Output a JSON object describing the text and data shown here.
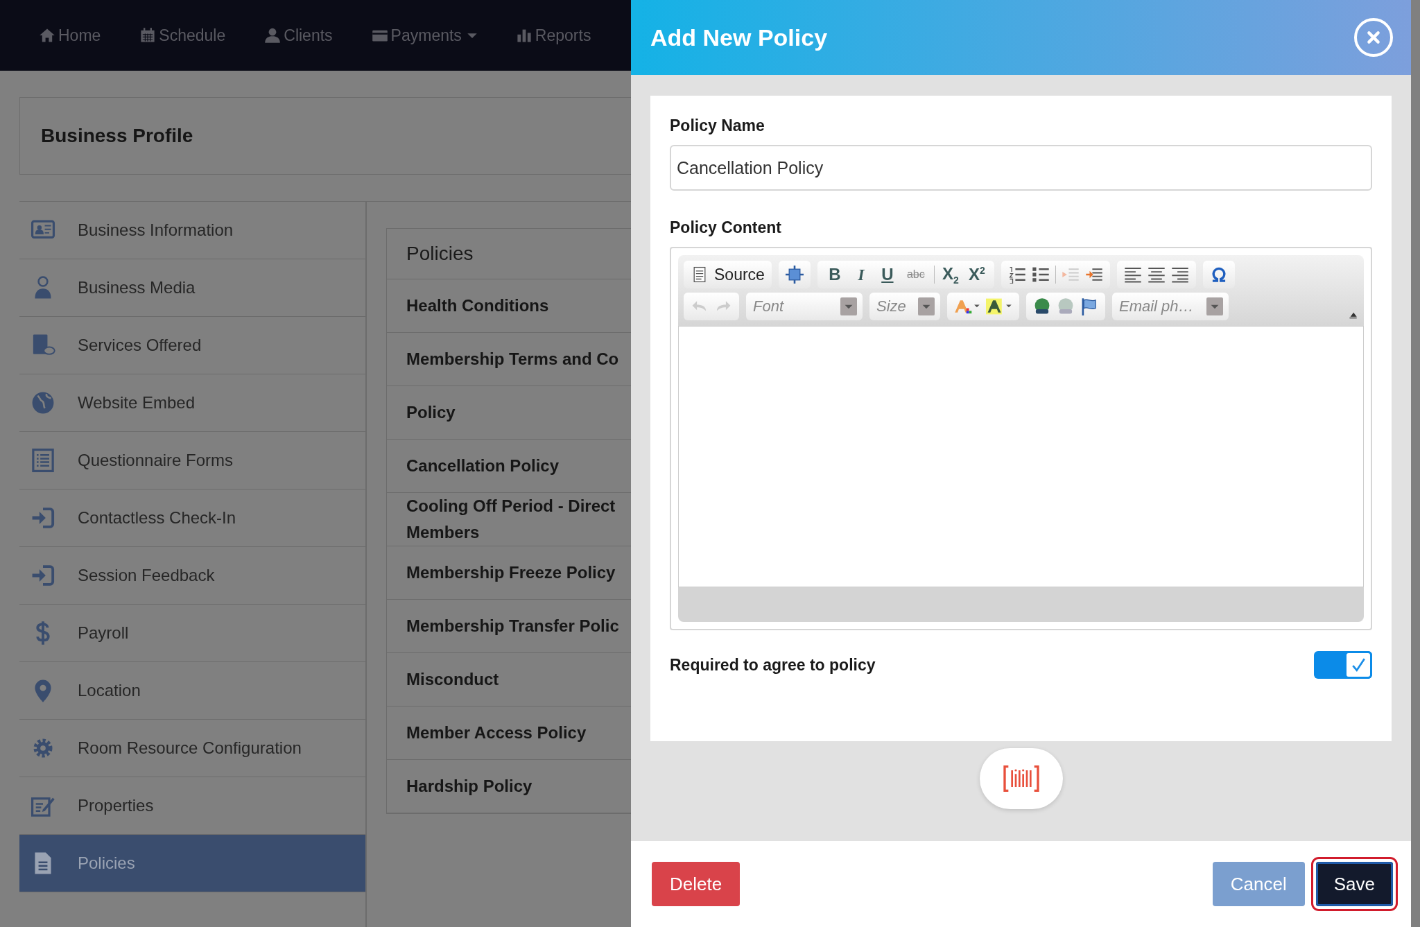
{
  "nav": {
    "items": [
      {
        "label": "Home",
        "dropdown": false
      },
      {
        "label": "Schedule",
        "dropdown": false
      },
      {
        "label": "Clients",
        "dropdown": false
      },
      {
        "label": "Payments",
        "dropdown": true
      },
      {
        "label": "Reports",
        "dropdown": false
      }
    ]
  },
  "page": {
    "title": "Business Profile"
  },
  "sidebar": {
    "items": [
      {
        "label": "Business Information",
        "selected": false
      },
      {
        "label": "Business Media",
        "selected": false
      },
      {
        "label": "Services Offered",
        "selected": false
      },
      {
        "label": "Website Embed",
        "selected": false
      },
      {
        "label": "Questionnaire Forms",
        "selected": false
      },
      {
        "label": "Contactless Check-In",
        "selected": false
      },
      {
        "label": "Session Feedback",
        "selected": false
      },
      {
        "label": "Payroll",
        "selected": false
      },
      {
        "label": "Location",
        "selected": false
      },
      {
        "label": "Room Resource Configuration",
        "selected": false
      },
      {
        "label": "Properties",
        "selected": false
      },
      {
        "label": "Policies",
        "selected": true
      }
    ]
  },
  "policies": {
    "title": "Policies",
    "items": [
      "Health Conditions",
      "Membership Terms and Co",
      "Policy",
      "Cancellation Policy",
      "Cooling Off Period - Direct Members",
      "Membership Freeze Policy",
      "Membership Transfer Polic",
      "Misconduct",
      "Member Access Policy",
      "Hardship Policy"
    ]
  },
  "modal": {
    "title": "Add New Policy",
    "name_label": "Policy Name",
    "name_value": "Cancellation Policy",
    "content_label": "Policy Content",
    "editor": {
      "source": "Source",
      "font_placeholder": "Font",
      "size_placeholder": "Size",
      "email_placeholder": "Email ph…",
      "format_buttons": [
        {
          "label": "B",
          "kind": "bold"
        },
        {
          "label": "I",
          "kind": "italic"
        },
        {
          "label": "U",
          "kind": "underline"
        },
        {
          "label": "abc",
          "kind": "strike"
        },
        {
          "label": "X$_{2}$",
          "kind": "subscript"
        },
        {
          "label": "X$^{2}$",
          "kind": "superscript"
        }
      ]
    },
    "required": {
      "label": "Required to agree to policy",
      "checked": true
    },
    "buttons": [
      {
        "label": "Delete",
        "kind": "danger",
        "focused": false
      },
      {
        "label": "Cancel",
        "kind": "secondary",
        "focused": false
      },
      {
        "label": "Save",
        "kind": "primary",
        "focused": true
      }
    ]
  }
}
